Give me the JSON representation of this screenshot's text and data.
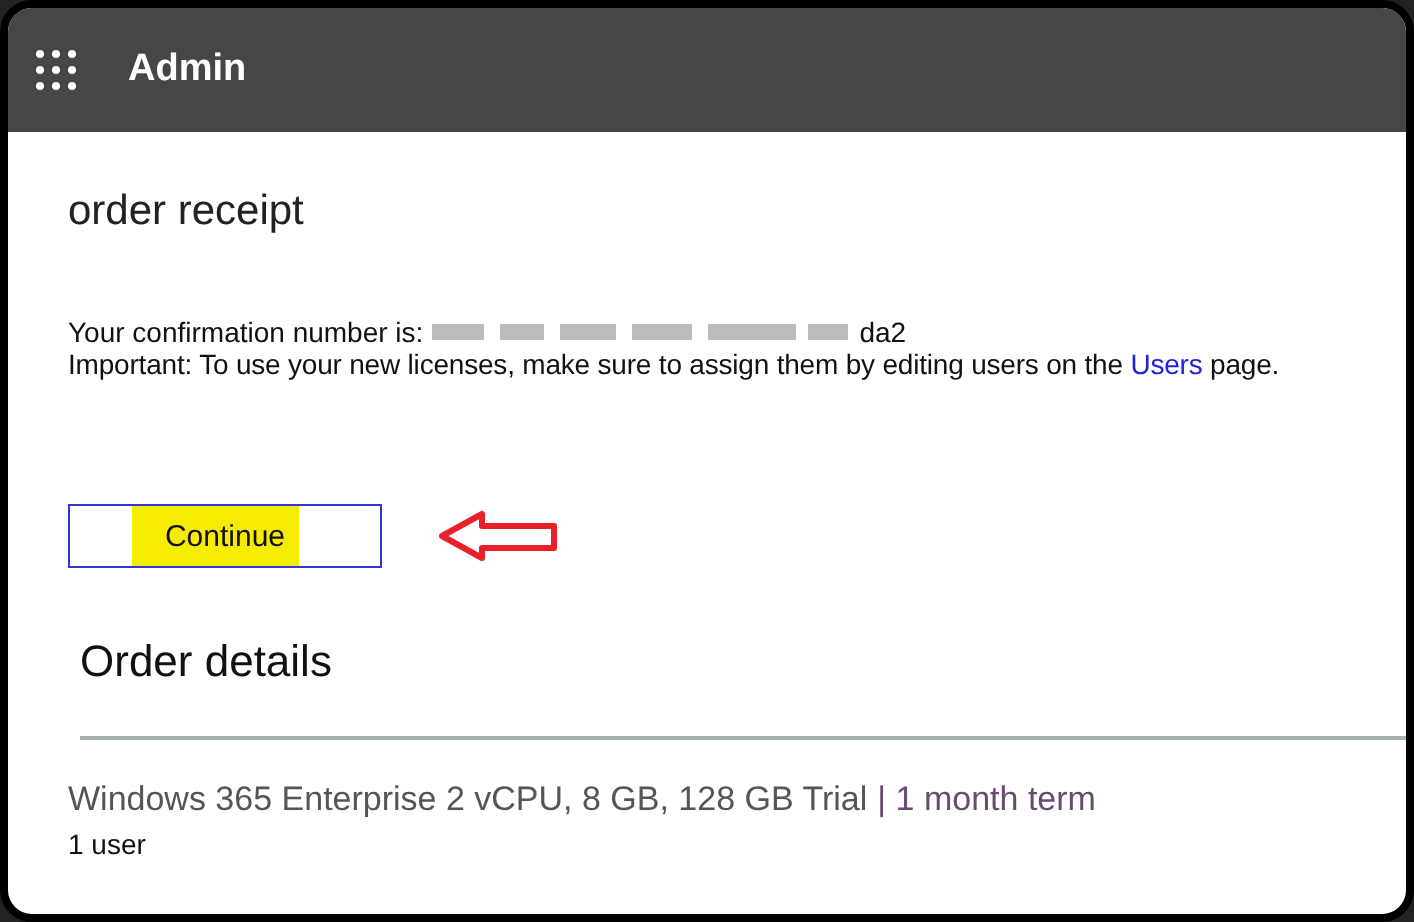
{
  "header": {
    "app_title": "Admin"
  },
  "page": {
    "title": "order receipt",
    "confirmation_label": "Your confirmation number is:",
    "confirmation_visible_end": "da2",
    "important_before": "Important: To use your new licenses, make sure to assign them by editing users on the ",
    "important_link": "Users",
    "important_after": " page.",
    "continue_button": "Continue"
  },
  "order_details": {
    "heading": "Order details",
    "items": [
      {
        "product": "Windows 365 Enterprise 2 vCPU, 8 GB, 128 GB Trial",
        "term": "| 1 month term",
        "quantity": "1 user"
      }
    ]
  }
}
